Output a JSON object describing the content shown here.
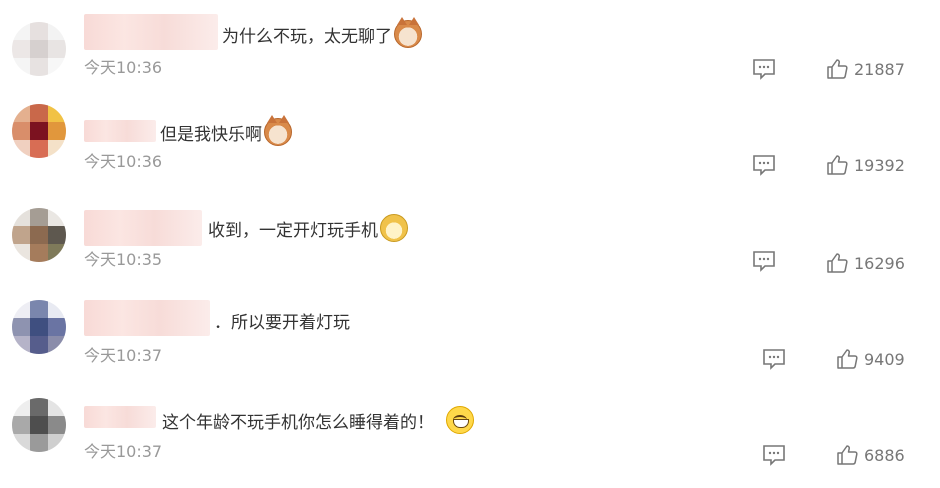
{
  "comments": [
    {
      "text": "为什么不玩，太无聊了",
      "emoji": "cat-face-icon",
      "time": "今天10:36",
      "likes": "21887"
    },
    {
      "text": "但是我快乐啊",
      "emoji": "cat-face-icon",
      "time": "今天10:36",
      "likes": "19392"
    },
    {
      "text": "收到，一定开灯玩手机",
      "emoji": "doge-face-icon",
      "time": "今天10:35",
      "likes": "16296"
    },
    {
      "text": "．所以要开着灯玩",
      "emoji": "",
      "time": "今天10:37",
      "likes": "9409"
    },
    {
      "text": "这个年龄不玩手机你怎么睡得着的！",
      "emoji": "grinning-face-icon",
      "time": "今天10:37",
      "likes": "6886"
    }
  ],
  "icons": {
    "reply": "comment-icon",
    "like": "thumbs-up-icon"
  },
  "colors": {
    "text": "#333333",
    "meta": "#999999",
    "icon": "#777777",
    "name_blur": "#f7d6d2"
  }
}
